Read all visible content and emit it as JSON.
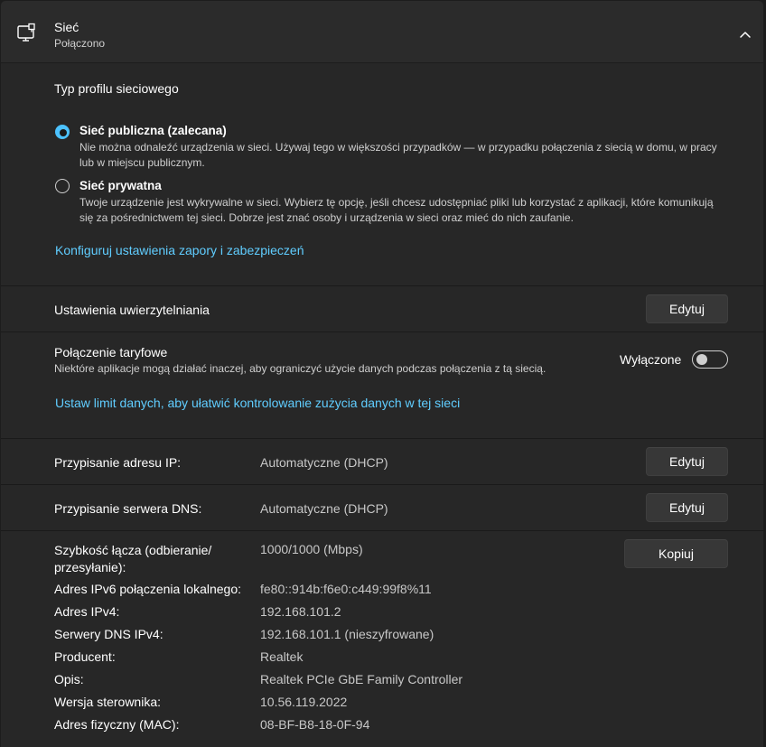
{
  "header": {
    "title": "Sieć",
    "subtitle": "Połączono",
    "icon": "network-monitor-icon"
  },
  "profile": {
    "heading": "Typ profilu sieciowego",
    "public": {
      "label": "Sieć publiczna (zalecana)",
      "desc_line1": "Nie można odnaleźć urządzenia w sieci. Używaj tego w większości przypadków — w przypadku połączenia z siecią w domu, w pracy",
      "desc_line2": "lub w miejscu publicznym.",
      "selected": true
    },
    "private": {
      "label": "Sieć prywatna",
      "desc_line1": "Twoje urządzenie jest wykrywalne w sieci. Wybierz tę opcję, jeśli chcesz udostępniać pliki lub korzystać z aplikacji, które komunikują",
      "desc_line2": "się za pośrednictwem tej sieci. Dobrze jest znać osoby i urządzenia w sieci oraz mieć do nich zaufanie.",
      "selected": false
    },
    "firewall_link": "Konfiguruj ustawienia zapory i zabezpieczeń"
  },
  "auth": {
    "label": "Ustawienia uwierzytelniania",
    "button": "Edytuj"
  },
  "metered": {
    "label": "Połączenie taryfowe",
    "desc": "Niektóre aplikacje mogą działać inaczej, aby ograniczyć użycie danych podczas połączenia z tą siecią.",
    "state_label": "Wyłączone",
    "on": false,
    "data_limit_link": "Ustaw limit danych, aby ułatwić kontrolowanie zużycia danych w tej sieci"
  },
  "ip": {
    "label": "Przypisanie adresu IP:",
    "value": "Automatyczne (DHCP)",
    "button": "Edytuj"
  },
  "dns": {
    "label": "Przypisanie serwera DNS:",
    "value": "Automatyczne (DHCP)",
    "button": "Edytuj"
  },
  "properties": {
    "copy_button": "Kopiuj",
    "speed_label_line1": "Szybkość łącza (odbieranie/",
    "speed_label_line2": "przesyłanie):",
    "speed_value": "1000/1000 (Mbps)",
    "rows": [
      {
        "label": "Adres IPv6 połączenia lokalnego:",
        "value": "fe80::914b:f6e0:c449:99f8%11"
      },
      {
        "label": "Adres IPv4:",
        "value": "192.168.101.2"
      },
      {
        "label": "Serwery DNS IPv4:",
        "value": "192.168.101.1 (nieszyfrowane)"
      },
      {
        "label": "Producent:",
        "value": "Realtek"
      },
      {
        "label": "Opis:",
        "value": "Realtek PCIe GbE Family Controller"
      },
      {
        "label": "Wersja sterownika:",
        "value": "10.56.119.2022"
      },
      {
        "label": "Adres fizyczny (MAC):",
        "value": "08-BF-B8-18-0F-94"
      }
    ]
  },
  "colors": {
    "accent": "#4cc2ff",
    "link": "#60cdff",
    "background": "#272727"
  }
}
